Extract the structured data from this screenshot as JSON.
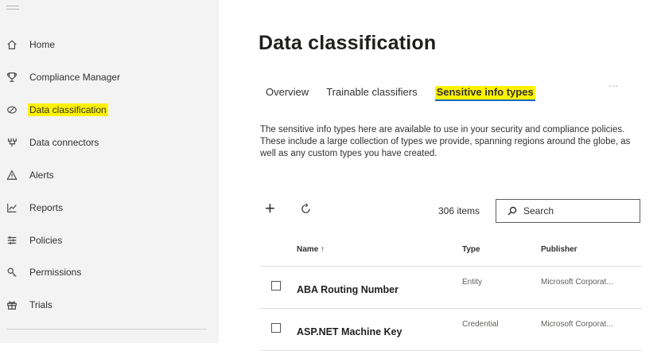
{
  "sidebar": {
    "items": [
      {
        "label": "Home",
        "icon": "home-icon"
      },
      {
        "label": "Compliance Manager",
        "icon": "trophy-icon"
      },
      {
        "label": "Data classification",
        "icon": "data-classification-icon"
      },
      {
        "label": "Data connectors",
        "icon": "connector-icon"
      },
      {
        "label": "Alerts",
        "icon": "alert-icon"
      },
      {
        "label": "Reports",
        "icon": "chart-line-icon"
      },
      {
        "label": "Policies",
        "icon": "policies-icon"
      },
      {
        "label": "Permissions",
        "icon": "permissions-key-icon"
      },
      {
        "label": "Trials",
        "icon": "gift-icon"
      }
    ]
  },
  "main": {
    "title": "Data classification",
    "tabs": [
      {
        "label": "Overview"
      },
      {
        "label": "Trainable classifiers"
      },
      {
        "label": "Sensitive info types"
      }
    ],
    "more": "...",
    "description": "The sensitive info types here are available to use in your security and compliance policies. These include a large collection of types we provide, spanning regions around the globe, as well as any custom types you have created.",
    "toolbar": {
      "add": "+",
      "count": "306 items",
      "search_placeholder": "Search"
    },
    "table": {
      "columns": {
        "name": "Name ↑",
        "type": "Type",
        "publisher": "Publisher"
      },
      "rows": [
        {
          "name": "ABA Routing Number",
          "type": "Entity",
          "publisher": "Microsoft Corporat..."
        },
        {
          "name": "ASP.NET Machine Key",
          "type": "Credential",
          "publisher": "Microsoft Corporat..."
        }
      ]
    }
  },
  "colors": {
    "highlight": "#fff200",
    "sidebar_bg": "#f3f3f3",
    "tab_underline": "#0f6cbd"
  }
}
